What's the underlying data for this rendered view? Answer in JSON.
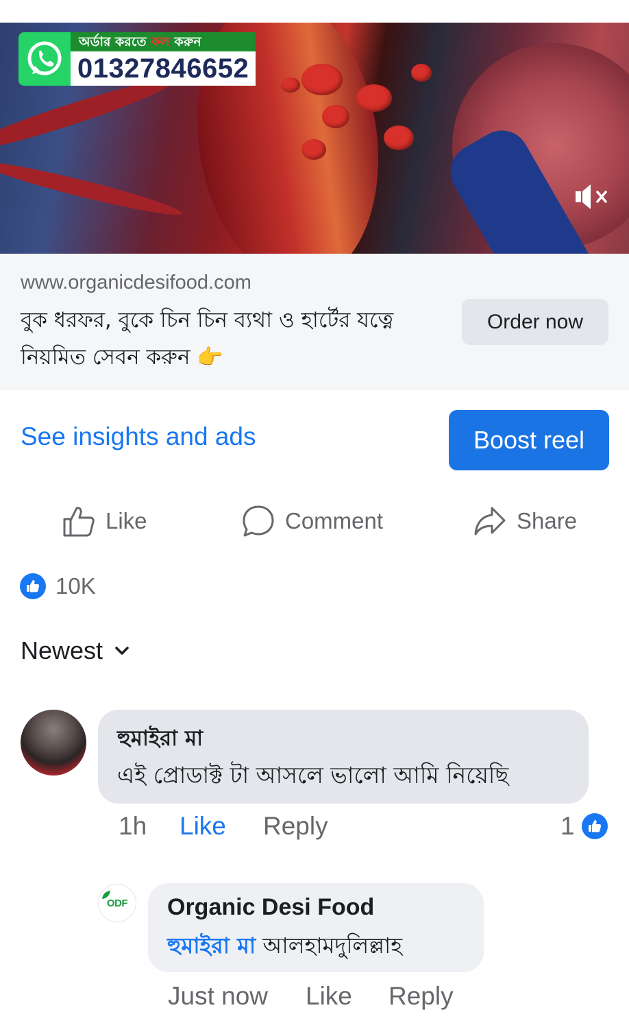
{
  "video": {
    "promo_top_part1": "অর্ডার করতে ",
    "promo_top_highlight": "কল",
    "promo_top_part2": " করুন",
    "phone": "01327846652",
    "mute_icon": "muted-speaker-icon"
  },
  "link_card": {
    "domain": "www.organicdesifood.com",
    "headline": "বুক ধরফর, বুকে চিন চিন ব্যথা ও হার্টের যত্নে নিয়মিত সেবন করুন 👉",
    "cta": "Order now"
  },
  "insights_label": "See insights and ads",
  "boost_label": "Boost reel",
  "actions": {
    "like": "Like",
    "comment": "Comment",
    "share": "Share"
  },
  "reactions": {
    "count": "10K",
    "icon": "thumbs-up-icon"
  },
  "sort_label": "Newest",
  "comments": [
    {
      "author": "হুমাইরা মা",
      "text": "এই প্রোডাক্ট টা আসলে ভালো আমি নিয়েছি",
      "time": "1h",
      "like": "Like",
      "reply": "Reply",
      "like_count": "1"
    },
    {
      "author": "Organic Desi Food",
      "avatar_text": "ODF",
      "mention": "হুমাইরা মা",
      "text": " আলহামদুলিল্লাহ",
      "time": "Just now",
      "like": "Like",
      "reply": "Reply"
    }
  ],
  "colors": {
    "accent": "#1877f2",
    "boost_bg": "#1b74e4",
    "whatsapp": "#25d366"
  }
}
